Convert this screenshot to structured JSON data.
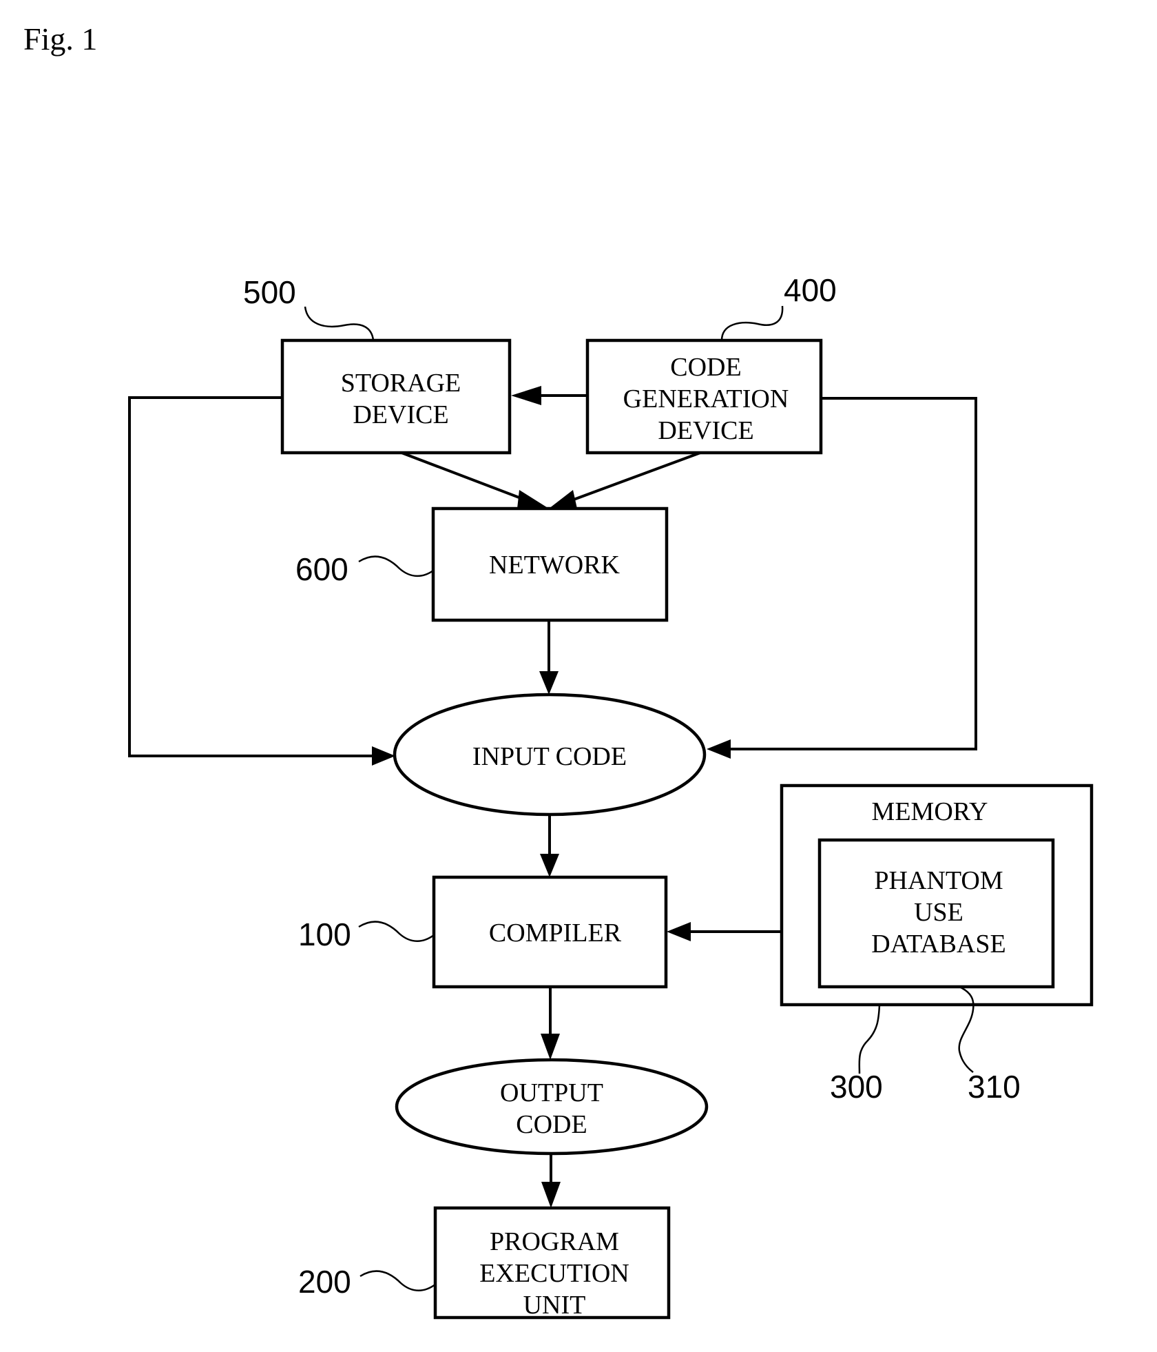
{
  "figure": {
    "title": "Fig. 1"
  },
  "nodes": {
    "storage_device": {
      "ref": "500",
      "lines": [
        "STORAGE",
        "DEVICE"
      ]
    },
    "code_generation_device": {
      "ref": "400",
      "lines": [
        "CODE",
        "GENERATION",
        "DEVICE"
      ]
    },
    "network": {
      "ref": "600",
      "lines": [
        "NETWORK"
      ]
    },
    "input_code": {
      "lines": [
        "INPUT CODE"
      ]
    },
    "memory": {
      "ref": "300",
      "lines": [
        "MEMORY"
      ]
    },
    "phantom_use_database": {
      "ref": "310",
      "lines": [
        "PHANTOM",
        "USE",
        "DATABASE"
      ]
    },
    "compiler": {
      "ref": "100",
      "lines": [
        "COMPILER"
      ]
    },
    "output_code": {
      "lines": [
        "OUTPUT",
        "CODE"
      ]
    },
    "program_execution_unit": {
      "ref": "200",
      "lines": [
        "PROGRAM",
        "EXECUTION",
        "UNIT"
      ]
    }
  },
  "edges": [
    {
      "from": "code_generation_device",
      "to": "storage_device"
    },
    {
      "from": "storage_device",
      "to": "network"
    },
    {
      "from": "code_generation_device",
      "to": "network"
    },
    {
      "from": "storage_device",
      "to": "input_code"
    },
    {
      "from": "code_generation_device",
      "to": "input_code"
    },
    {
      "from": "network",
      "to": "input_code"
    },
    {
      "from": "input_code",
      "to": "compiler"
    },
    {
      "from": "phantom_use_database",
      "to": "compiler"
    },
    {
      "from": "compiler",
      "to": "output_code"
    },
    {
      "from": "output_code",
      "to": "program_execution_unit"
    }
  ]
}
